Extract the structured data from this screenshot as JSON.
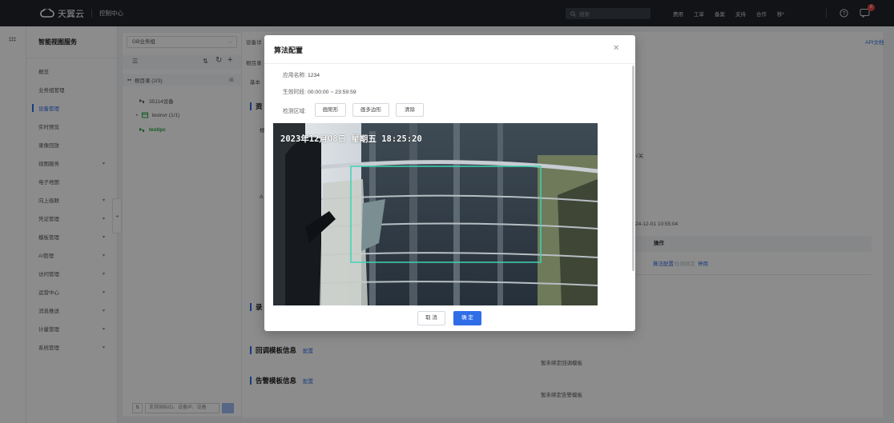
{
  "topbar": {
    "brand": "天翼云",
    "console": "控制中心",
    "search_placeholder": "搜索",
    "nav": [
      "费用",
      "工单",
      "备案",
      "支持",
      "合作",
      "移*"
    ],
    "notification_count": "6"
  },
  "sidebar": {
    "title": "智能视图服务",
    "items": [
      {
        "label": "概览",
        "chevron": ""
      },
      {
        "label": "业务组管理",
        "chevron": ""
      },
      {
        "label": "设备管理",
        "chevron": ""
      },
      {
        "label": "实时预览",
        "chevron": ""
      },
      {
        "label": "录像回放",
        "chevron": ""
      },
      {
        "label": "视图服务",
        "chevron": "▾"
      },
      {
        "label": "电子地图",
        "chevron": ""
      },
      {
        "label": "向上级联",
        "chevron": "▾"
      },
      {
        "label": "凭证管理",
        "chevron": "▾"
      },
      {
        "label": "模板管理",
        "chevron": "▾"
      },
      {
        "label": "AI管理",
        "chevron": "▾"
      },
      {
        "label": "访问管理",
        "chevron": "▾"
      },
      {
        "label": "运营中心",
        "chevron": "▾"
      },
      {
        "label": "消息推送",
        "chevron": "▾"
      },
      {
        "label": "计量管理",
        "chevron": "▾"
      },
      {
        "label": "系统管理",
        "chevron": "▾"
      }
    ],
    "collapse_glyph": "◂"
  },
  "tree": {
    "business_group": "GB业务组",
    "root_label": "根目录 (2/3)",
    "nodes": [
      {
        "label": "35114设备"
      },
      {
        "label": "testnvr (1/1)"
      },
      {
        "label": "testipc"
      }
    ],
    "search_placeholder": "支持国标ID、设备IP、设备"
  },
  "main": {
    "api_doc": "API文档",
    "tab_partial": "设备详",
    "breadcrumb_partial": "根目录",
    "basic_partial": "基本",
    "section_resource_partial": "资",
    "row_label_partial": "根",
    "text_close_partial": "√关",
    "row_label_a": "A",
    "timestamp": "24-12-01 10:55:04",
    "ops_header": "操作",
    "ops": [
      "算法配置",
      "检测绑定",
      "停用"
    ],
    "section_record_partial": "录",
    "callback_title": "回调模板信息",
    "callback_config": "配置",
    "callback_empty": "暂未绑定回调模板",
    "alarm_title": "告警模板信息",
    "alarm_config": "配置",
    "alarm_empty": "暂未绑定告警模板"
  },
  "modal": {
    "title": "算法配置",
    "app_name_label": "应用名称:",
    "app_name": "1234",
    "effective_label": "生效时段:",
    "effective": "00:00:00 ~ 23:59:59",
    "detect_label": "检测区域:",
    "btn_rect": "画矩形",
    "btn_polygon": "画多边形",
    "btn_clear": "清除",
    "osd_text": "2023年12月08日 星期五 18:25:20",
    "cancel": "取 消",
    "confirm": "确 定"
  },
  "colors": {
    "primary": "#2f6ee6",
    "topbar": "#1f2329",
    "region": "#3fd3b4",
    "tree_active": "#27a63b"
  }
}
